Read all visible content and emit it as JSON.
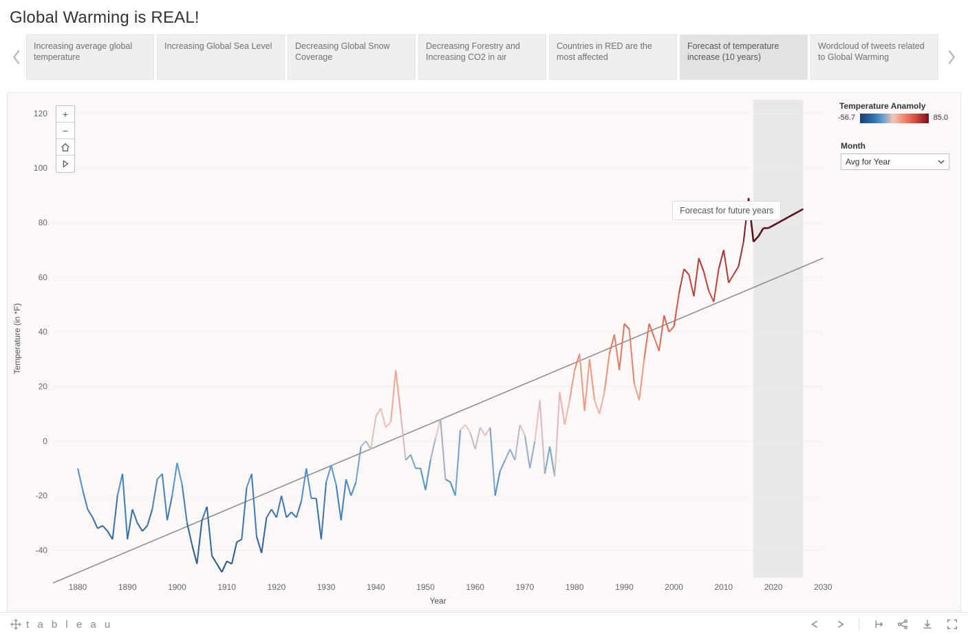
{
  "title": "Global Warming is REAL!",
  "story_points": [
    "Increasing average global temperature",
    "Increasing Global Sea Level",
    "Decreasing Global Snow Coverage",
    "Decreasing Forestry and Increasing CO2 in air",
    "Countries in RED are the most affected",
    "Forecast of temperature increase (10 years)",
    "Wordcloud of tweets related to Global Warming"
  ],
  "active_story_index": 5,
  "legend": {
    "title": "Temperature Anamoly",
    "min": "-56.7",
    "max": "85.0"
  },
  "month_filter": {
    "label": "Month",
    "value": "Avg for Year"
  },
  "annotation": "Forecast for future years",
  "footer_brand": "t a b l e a u",
  "chart_data": {
    "type": "line",
    "title": "",
    "xlabel": "Year",
    "ylabel": "Temperature (in *F)",
    "xlim": [
      1875,
      2030
    ],
    "ylim": [
      -50,
      125
    ],
    "yticks": [
      -40,
      -20,
      0,
      20,
      40,
      60,
      80,
      100,
      120
    ],
    "xticks": [
      1880,
      1890,
      1900,
      1910,
      1920,
      1930,
      1940,
      1950,
      1960,
      1970,
      1980,
      1990,
      2000,
      2010,
      2020,
      2030
    ],
    "trend_line": {
      "x": [
        1875,
        2030
      ],
      "y": [
        -52,
        67
      ]
    },
    "forecast_band": {
      "x0": 2016,
      "x1": 2026
    },
    "series": [
      {
        "name": "Avg for Year",
        "x_start": 1880,
        "values": [
          -10,
          -18,
          -25,
          -28,
          -32,
          -31,
          -33,
          -36,
          -20,
          -12,
          -36,
          -25,
          -30,
          -33,
          -31,
          -25,
          -14,
          -12,
          -29,
          -20,
          -8,
          -16,
          -30,
          -38,
          -45,
          -29,
          -24,
          -42,
          -45,
          -48,
          -44,
          -45,
          -37,
          -36,
          -17,
          -12,
          -35,
          -41,
          -28,
          -25,
          -28,
          -20,
          -28,
          -26,
          -28,
          -22,
          -10,
          -21,
          -21,
          -36,
          -15,
          -9,
          -16,
          -29,
          -14,
          -20,
          -15,
          -2,
          0,
          -3,
          9,
          12,
          5,
          7,
          26,
          10,
          -7,
          -5,
          -10,
          -10,
          -18,
          -7,
          1,
          8,
          -14,
          -15,
          -20,
          4,
          6,
          3,
          -3,
          5,
          2,
          5,
          -20,
          -11,
          -7,
          -3,
          -7,
          6,
          2,
          -10,
          0,
          15,
          -12,
          -2,
          -13,
          18,
          6,
          15,
          26,
          32,
          11,
          30,
          15,
          10,
          18,
          32,
          39,
          26,
          43,
          41,
          21,
          15,
          30,
          43,
          38,
          33,
          46,
          40,
          42,
          54,
          63,
          61,
          53,
          67,
          62,
          55,
          51,
          63,
          70,
          58,
          61,
          64,
          73,
          89,
          73,
          75,
          78,
          78,
          79,
          80,
          81,
          82,
          83,
          84,
          85
        ]
      }
    ],
    "forecast_start_index": 136
  }
}
